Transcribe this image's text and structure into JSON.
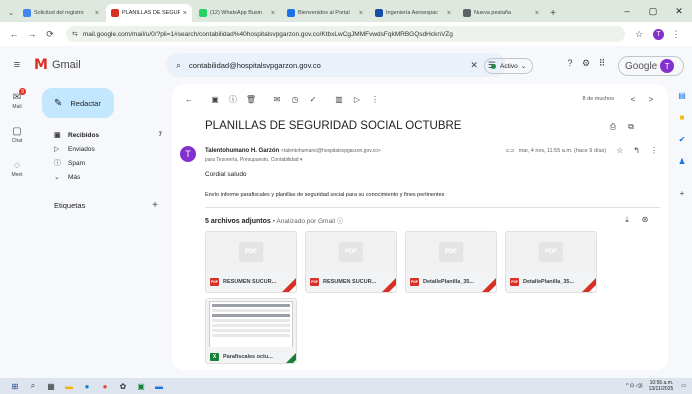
{
  "browser": {
    "tabs": [
      {
        "title": "Solicitud del registro",
        "color": "#4285f4",
        "active": false
      },
      {
        "title": "PLANILLAS DE SEGURI",
        "color": "#d93025",
        "active": true
      },
      {
        "title": "(12) WhatsApp Busin",
        "color": "#25d366",
        "active": false
      },
      {
        "title": "Bienvenidos al Portal",
        "color": "#1a73e8",
        "active": false
      },
      {
        "title": "Ingeniería Aeroespac",
        "color": "#174ea6",
        "active": false
      },
      {
        "title": "Nueva pestaña",
        "color": "#5f6368",
        "active": false
      }
    ],
    "url": "mail.google.com/mail/u/0/?pli=1#search/contabilidad%40hospitalsvpgarzon.gov.co/KtbxLwCgJMMFvwdsFqkMRBGQsdHcknVZg",
    "tab_close_glyph": "×",
    "new_tab_glyph": "+",
    "tab_dropdown_glyph": "⌄",
    "minimize_glyph": "–",
    "maximize_glyph": "▢",
    "close_glyph": "✕",
    "back_glyph": "←",
    "forward_glyph": "→",
    "reload_glyph": "⟳",
    "site_glyph": "⇆",
    "star_glyph": "☆",
    "menu_glyph": "⋮",
    "profile_initial": "T"
  },
  "gmail": {
    "app_name": "Gmail",
    "logo_letter": "M",
    "menu_glyph": "≡",
    "search_glyph": "⌕",
    "search_query": "contabilidad@hospitalsvpgarzon.gov.co",
    "search_clear_glyph": "✕",
    "search_filter_glyph": "☰",
    "status_label": "Activo",
    "status_chevron": "⌄",
    "header_icons": [
      "?",
      "⚙",
      "⠿"
    ],
    "account_label": "Google",
    "account_initial": "T",
    "rail": [
      {
        "label": "Mail",
        "icon": "✉",
        "badge": "9"
      },
      {
        "label": "Chat",
        "icon": "▢",
        "badge": ""
      },
      {
        "label": "Meet",
        "icon": "◌",
        "badge": ""
      }
    ],
    "compose_label": "Redactar",
    "compose_glyph": "✎",
    "nav": [
      {
        "label": "Recibidos",
        "icon": "▣",
        "count": "7",
        "bold": true
      },
      {
        "label": "Enviados",
        "icon": "▷",
        "count": "",
        "bold": false
      },
      {
        "label": "Spam",
        "icon": "ⓘ",
        "count": "",
        "bold": false
      },
      {
        "label": "Más",
        "icon": "⌄",
        "count": "",
        "bold": false
      }
    ],
    "labels_heading": "Etiquetas",
    "labels_add_glyph": "+",
    "right_rail_icons": [
      {
        "glyph": "▤",
        "color": "#1a73e8"
      },
      {
        "glyph": "■",
        "color": "#fbbc04"
      },
      {
        "glyph": "✔",
        "color": "#1a73e8"
      },
      {
        "glyph": "♟",
        "color": "#1a73e8"
      },
      {
        "glyph": "+",
        "color": "#444444"
      }
    ]
  },
  "message": {
    "toolbar_icons": [
      "←",
      "▣",
      "ⓘ",
      "🗑",
      "✉",
      "◷",
      "✓",
      "▥",
      "▷",
      "⋮"
    ],
    "pagination": "8 de muchos",
    "prev_glyph": "<",
    "next_glyph": ">",
    "subject": "PLANILLAS DE SEGURIDAD SOCIAL OCTUBRE",
    "print_glyph": "⎙",
    "newwin_glyph": "⧉",
    "sender_initial": "T",
    "sender_name": "Talentohumano H. Garzón",
    "sender_email": "<talentohumano@hospitalsvpgarzon.gov.co>",
    "to_line": "para Tesorería, Presupuesto, Contabilidad ▾",
    "date": "mar, 4 nov, 11:55 a.m. (hace 9 días)",
    "attach_glyph": "⊂⊃",
    "star_glyph": "☆",
    "reply_glyph": "↰",
    "more_glyph": "⋮",
    "greeting": "Cordial saludo",
    "body": "Envío informe parafiscales y planillas de seguridad social para su conocimiento y fines pertinentes",
    "attachments_count_label": "5 archivos adjuntos",
    "attachments_scan": "• Analizado por Gmail ⓘ",
    "download_all_glyph": "⤓",
    "drive_glyph": "⊛",
    "attachments": [
      {
        "name": "RESUMEN SUCUR...",
        "type": "pdf",
        "thumb": "PDF",
        "badge": "PDF"
      },
      {
        "name": "RESUMEN SUCUR...",
        "type": "pdf",
        "thumb": "PDF",
        "badge": "PDF"
      },
      {
        "name": "DetallePlanilla_35...",
        "type": "pdf",
        "thumb": "PDF",
        "badge": "PDF"
      },
      {
        "name": "DetallePlanilla_35...",
        "type": "pdf",
        "thumb": "PDF",
        "badge": "PDF"
      },
      {
        "name": "Parafiscales octu...",
        "type": "xls",
        "thumb": "",
        "badge": "X"
      }
    ]
  },
  "taskbar": {
    "icons": [
      {
        "glyph": "⊞",
        "color": "#1a3c8c"
      },
      {
        "glyph": "⌕",
        "color": "#333333"
      },
      {
        "glyph": "▦",
        "color": "#333333"
      },
      {
        "glyph": "▬",
        "color": "#f2b600"
      },
      {
        "glyph": "●",
        "color": "#0a84d8"
      },
      {
        "glyph": "●",
        "color": "#ea4335"
      },
      {
        "glyph": "✿",
        "color": "#333333"
      },
      {
        "glyph": "▣",
        "color": "#188038"
      },
      {
        "glyph": "▬",
        "color": "#1a73e8"
      }
    ],
    "tray": "^ ⊡ ◁))",
    "time": "10:56 a.m.",
    "date": "13/11/2025",
    "notif_glyph": "▭"
  }
}
